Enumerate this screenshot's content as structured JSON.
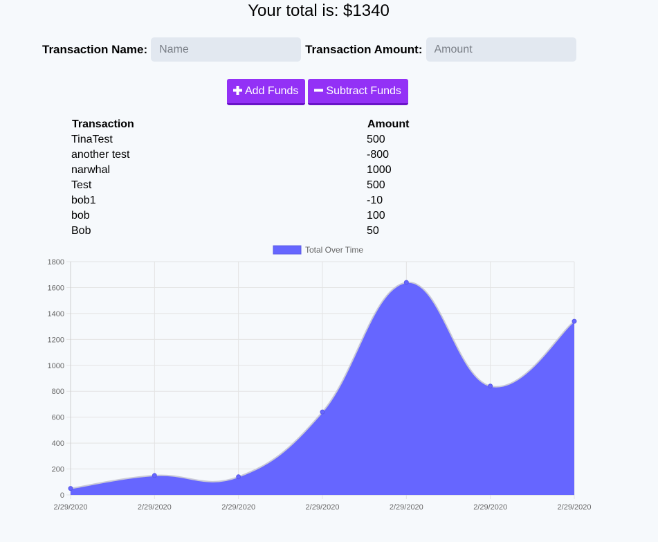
{
  "header": {
    "total_label": "Your total is: $1340"
  },
  "form": {
    "name_label": "Transaction Name:",
    "name_placeholder": "Name",
    "amount_label": "Transaction Amount:",
    "amount_placeholder": "Amount"
  },
  "buttons": {
    "add_icon": "plus-icon",
    "add_label": "Add Funds",
    "subtract_icon": "minus-icon",
    "subtract_label": "Subtract Funds",
    "color": "#9331f6"
  },
  "table": {
    "headers": [
      "Transaction",
      "Amount"
    ],
    "rows": [
      [
        "TinaTest",
        "500"
      ],
      [
        "another test",
        "-800"
      ],
      [
        "narwhal",
        "1000"
      ],
      [
        "Test",
        "500"
      ],
      [
        "bob1",
        "-10"
      ],
      [
        "bob",
        "100"
      ],
      [
        "Bob",
        "50"
      ]
    ]
  },
  "chart_data": {
    "type": "area",
    "legend_position": "top",
    "grid": true,
    "categories": [
      "2/29/2020",
      "2/29/2020",
      "2/29/2020",
      "2/29/2020",
      "2/29/2020",
      "2/29/2020",
      "2/29/2020"
    ],
    "series": [
      {
        "name": "Total Over Time",
        "values": [
          50,
          150,
          140,
          640,
          1640,
          840,
          1340
        ],
        "color": "#6666ff"
      }
    ],
    "ylim": [
      0,
      1800
    ],
    "yticks": [
      0,
      200,
      400,
      600,
      800,
      1000,
      1200,
      1400,
      1600,
      1800
    ]
  }
}
